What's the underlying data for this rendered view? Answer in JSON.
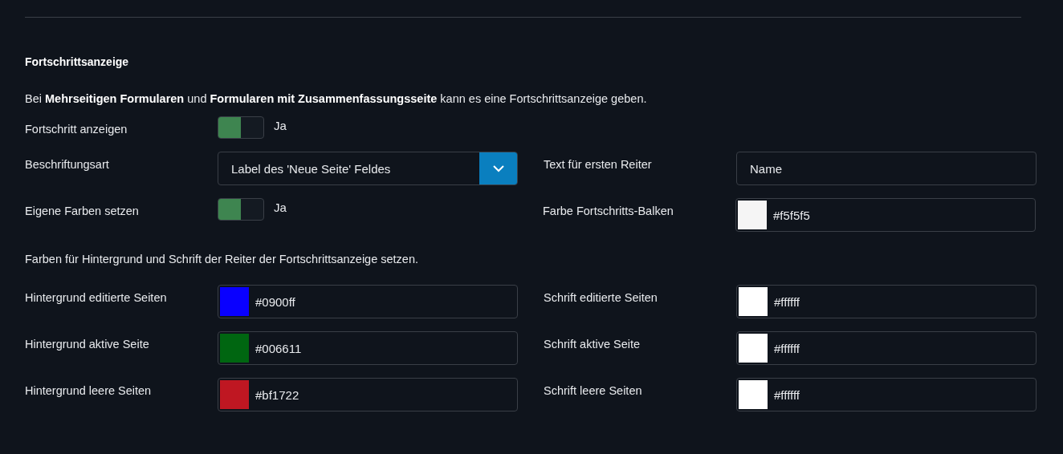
{
  "section": {
    "title": "Fortschrittsanzeige",
    "intro": "Bei **Mehrseitigen Formularen** und **Formularen mit Zusammenfassungsseite** kann es eine Fortschrittsanzeige geben."
  },
  "rows": [
    {
      "kind": "fields",
      "left": {
        "kind": "toggle",
        "label": "Fortschritt anzeigen",
        "on": true,
        "value": "Ja"
      }
    },
    {
      "kind": "fields",
      "left": {
        "kind": "select",
        "label": "Beschriftungsart",
        "value": "Label des 'Neue Seite' Feldes"
      },
      "right": {
        "kind": "text",
        "label": "Text für ersten Reiter",
        "value": "Name"
      }
    },
    {
      "kind": "fields",
      "left": {
        "kind": "toggle",
        "label": "Eigene Farben setzen",
        "on": true,
        "value": "Ja"
      },
      "right": {
        "kind": "color",
        "label": "Farbe Fortschritts-Balken",
        "value": "#f5f5f5",
        "color": "#f5f5f5"
      }
    },
    {
      "kind": "note",
      "text": "Farben für Hintergrund und Schrift der Reiter der Fortschrittsanzeige setzen."
    },
    {
      "kind": "fields",
      "left": {
        "kind": "color",
        "label": "Hintergrund editierte Seiten",
        "value": "#0900ff",
        "color": "#0900ff"
      },
      "right": {
        "kind": "color",
        "label": "Schrift editierte Seiten",
        "value": "#ffffff",
        "color": "#ffffff"
      }
    },
    {
      "kind": "fields",
      "left": {
        "kind": "color",
        "label": "Hintergrund aktive Seite",
        "value": "#006611",
        "color": "#006611"
      },
      "right": {
        "kind": "color",
        "label": "Schrift aktive Seite",
        "value": "#ffffff",
        "color": "#ffffff"
      }
    },
    {
      "kind": "fields",
      "left": {
        "kind": "color",
        "label": "Hintergrund leere Seiten",
        "value": "#bf1722",
        "color": "#bf1722"
      },
      "right": {
        "kind": "color",
        "label": "Schrift leere Seiten",
        "value": "#ffffff",
        "color": "#ffffff"
      }
    }
  ]
}
